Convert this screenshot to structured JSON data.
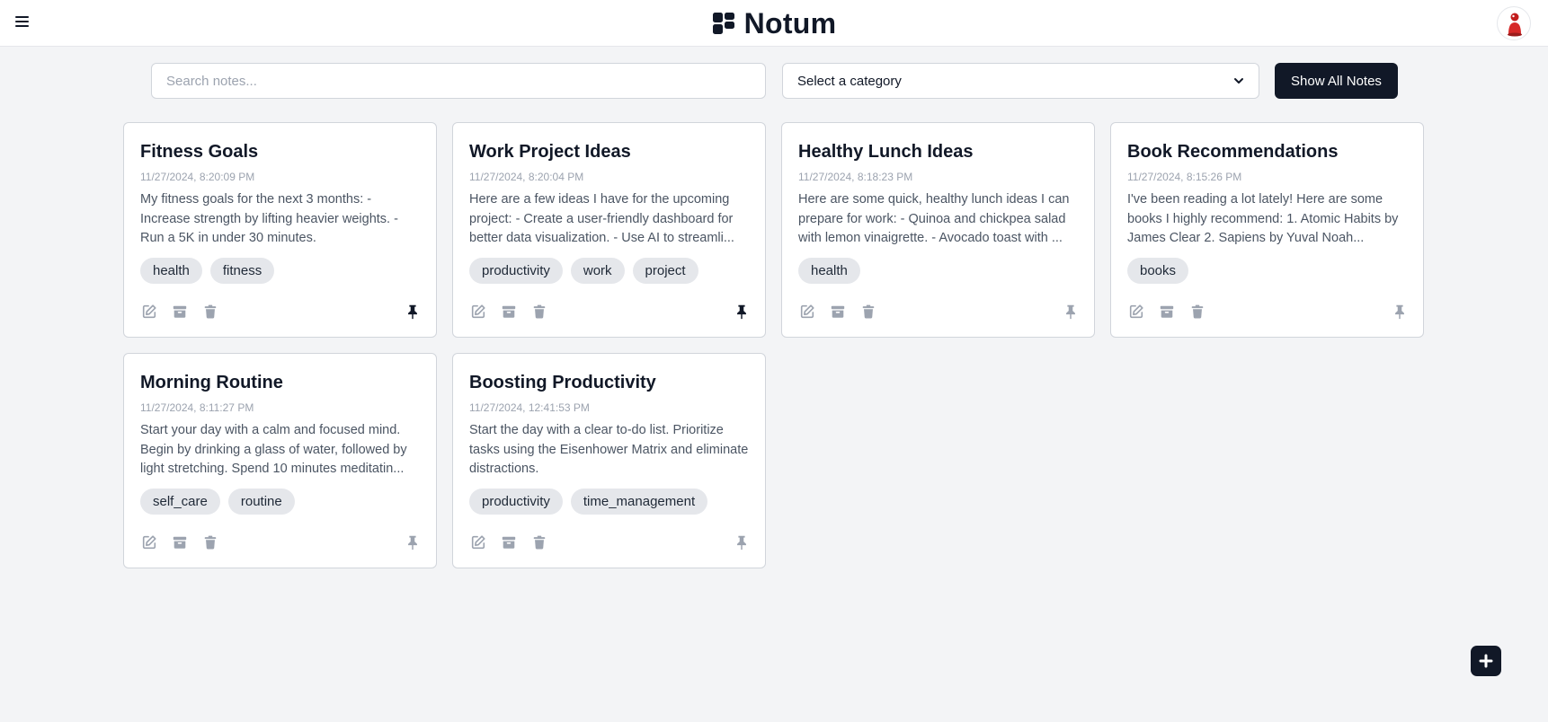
{
  "app": {
    "name": "Notum",
    "menu_icon": "hamburger-menu-icon",
    "logo_icon": "notes-grid-logo-icon",
    "avatar_icon": "user-avatar"
  },
  "toolbar": {
    "search_placeholder": "Search notes...",
    "category_selected": "Select a category",
    "show_all_label": "Show All Notes"
  },
  "notes": [
    {
      "title": "Fitness Goals",
      "date": "11/27/2024, 8:20:09 PM",
      "body": "My fitness goals for the next 3 months: - Increase strength by lifting heavier weights. - Run a 5K in under 30 minutes.",
      "tags": [
        "health",
        "fitness"
      ],
      "pinned": true
    },
    {
      "title": "Work Project Ideas",
      "date": "11/27/2024, 8:20:04 PM",
      "body": "Here are a few ideas I have for the upcoming project: - Create a user-friendly dashboard for better data visualization. - Use AI to streamli...",
      "tags": [
        "productivity",
        "work",
        "project"
      ],
      "pinned": true
    },
    {
      "title": "Healthy Lunch Ideas",
      "date": "11/27/2024, 8:18:23 PM",
      "body": "Here are some quick, healthy lunch ideas I can prepare for work: - Quinoa and chickpea salad with lemon vinaigrette. - Avocado toast with ...",
      "tags": [
        "health"
      ],
      "pinned": false
    },
    {
      "title": "Book Recommendations",
      "date": "11/27/2024, 8:15:26 PM",
      "body": "I've been reading a lot lately! Here are some books I highly recommend: 1. Atomic Habits by James Clear 2. Sapiens by Yuval Noah...",
      "tags": [
        "books"
      ],
      "pinned": false
    },
    {
      "title": "Morning Routine",
      "date": "11/27/2024, 8:11:27 PM",
      "body": "Start your day with a calm and focused mind. Begin by drinking a glass of water, followed by light stretching. Spend 10 minutes meditatin...",
      "tags": [
        "self_care",
        "routine"
      ],
      "pinned": false
    },
    {
      "title": "Boosting Productivity",
      "date": "11/27/2024, 12:41:53 PM",
      "body": "Start the day with a clear to-do list. Prioritize tasks using the Eisenhower Matrix and eliminate distractions.",
      "tags": [
        "productivity",
        "time_management"
      ],
      "pinned": false
    }
  ],
  "icons": {
    "edit": "edit-icon",
    "archive": "archive-icon",
    "delete": "trash-icon",
    "pin": "pin-icon",
    "add": "plus-icon"
  },
  "colors": {
    "primary": "#111827",
    "background": "#f3f4f6",
    "icon_muted": "#9ca3af",
    "tag_bg": "#e5e7eb"
  }
}
